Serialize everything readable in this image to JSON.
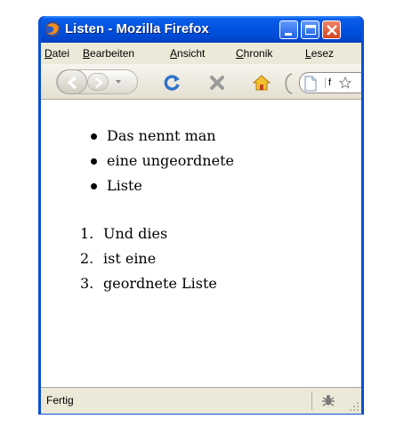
{
  "window": {
    "title": "Listen - Mozilla Firefox",
    "icon": "firefox-icon",
    "controls": [
      "minimize-icon",
      "maximize-icon",
      "close-icon"
    ]
  },
  "menubar": {
    "items": [
      {
        "label": "Datei",
        "accel": "D",
        "rest": "atei"
      },
      {
        "label": "Bearbeiten",
        "accel": "B",
        "rest": "earbeiten"
      },
      {
        "label": "Ansicht",
        "accel": "A",
        "rest": "nsicht"
      },
      {
        "label": "Chronik",
        "accel": "C",
        "rest": "hronik"
      },
      {
        "label": "Lesez",
        "accel": "L",
        "rest": "esez"
      }
    ]
  },
  "toolbar": {
    "icons": [
      "back-arrow-icon",
      "forward-arrow-icon",
      "dropdown-icon",
      "reload-icon",
      "stop-icon",
      "home-icon",
      "page-icon",
      "bookmark-star-icon"
    ],
    "url_value": "f"
  },
  "content": {
    "unordered_list": [
      "Das nennt man",
      "eine ungeordnete",
      "Liste"
    ],
    "ordered_list": [
      {
        "number": "1.",
        "text": "Und dies"
      },
      {
        "number": "2.",
        "text": "ist eine"
      },
      {
        "number": "3.",
        "text": "geordnete Liste"
      }
    ]
  },
  "statusbar": {
    "text": "Fertig",
    "icon": "bug-icon"
  }
}
